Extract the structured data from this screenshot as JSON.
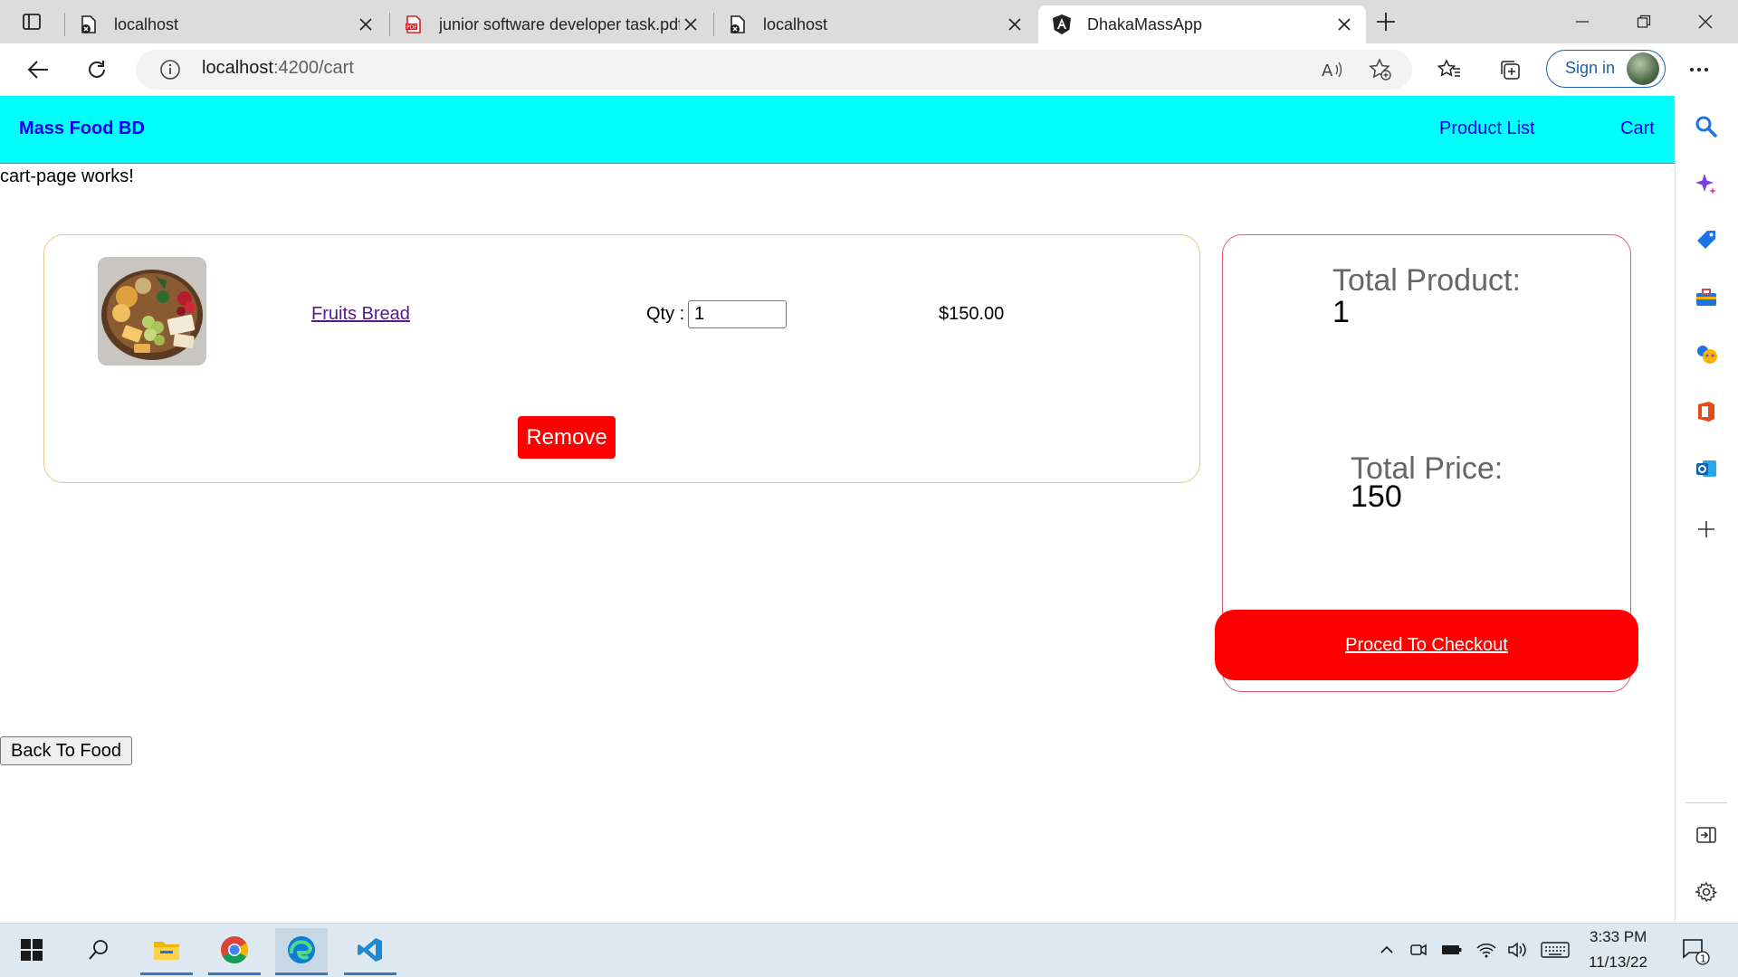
{
  "browser": {
    "tabs": [
      {
        "title": "localhost",
        "icon": "site-icon",
        "active": false
      },
      {
        "title": "junior software developer task.pdf",
        "icon": "pdf-icon",
        "active": false
      },
      {
        "title": "localhost",
        "icon": "site-icon",
        "active": false
      },
      {
        "title": "DhakaMassApp",
        "icon": "angular-icon",
        "active": true
      }
    ],
    "url_host": "localhost",
    "url_rest": ":4200/cart",
    "sign_in_label": "Sign in",
    "accent": "#1f5fa8"
  },
  "app": {
    "brand": "Mass Food BD",
    "nav": {
      "products": "Product List",
      "cart": "Cart"
    },
    "nav_bg": "#00ffff",
    "debug_text": "cart-page works!",
    "cart_item": {
      "name": "Fruits Bread",
      "qty_label": "Qty :",
      "qty": "1",
      "price": "$150.00",
      "remove_label": "Remove"
    },
    "summary": {
      "total_product_label": "Total Product:",
      "total_product": "1",
      "total_price_label": "Total Price:",
      "total_price": "150",
      "checkout_label": "Proced To Checkout"
    },
    "back_label": "Back To Food",
    "danger_color": "#ff0000"
  },
  "taskbar": {
    "time": "3:33 PM",
    "date": "11/13/22",
    "notification_count": "1"
  }
}
